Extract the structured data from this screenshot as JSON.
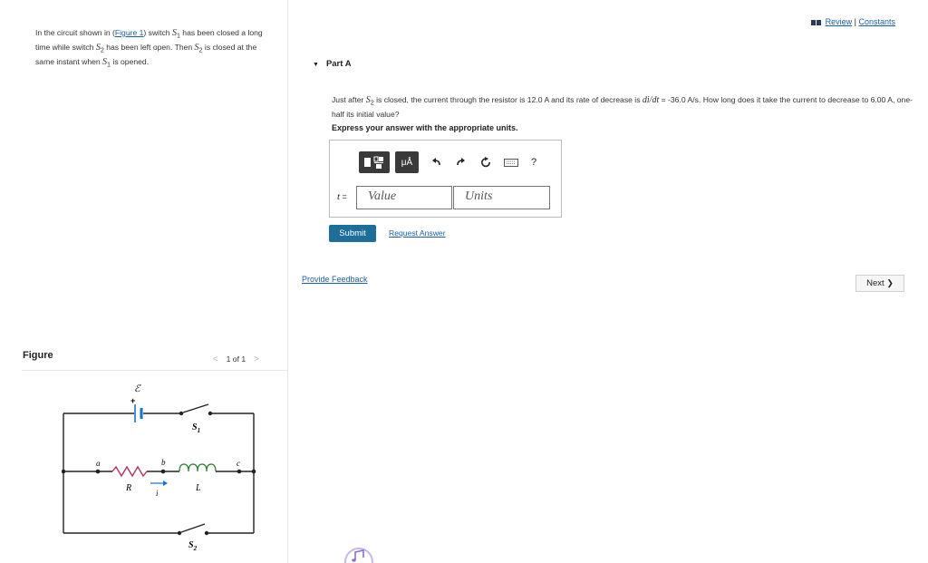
{
  "problem": {
    "t1": "In the circuit shown in (",
    "figure_link": "Figure 1",
    "t2": ") switch ",
    "s1": "S",
    "s1_sub": "1",
    "t3": " has been closed a long time while switch ",
    "s2": "S",
    "s2_sub": "2",
    "t4": " has been left open. Then ",
    "t5": " is closed at the same instant when ",
    "t6": " is opened."
  },
  "figure": {
    "label": "Figure",
    "pager": "1 of 1",
    "prev_arrow": "<",
    "next_arrow": ">",
    "circuit_labels": {
      "emf": "ℰ",
      "plus": "+",
      "s1": "S",
      "s1_sub": "1",
      "s2": "S",
      "s2_sub": "2",
      "a": "a",
      "b": "b",
      "c": "c",
      "R": "R",
      "L": "L",
      "i": "i"
    }
  },
  "header": {
    "review": "Review",
    "separator": " | ",
    "constants": "Constants"
  },
  "part": {
    "title": "Part A",
    "q1": "Just after ",
    "q_s2": "S",
    "q_s2_sub": "2",
    "q2": " is closed, the current through the resistor is 12.0 ",
    "unit_A": "A",
    "q3": " and its rate of decrease is ",
    "didt": "di/dt",
    "q4": " = -36.0 ",
    "unit_As": "A/s",
    "q5": ". How long does it take the current to decrease to 6.00 ",
    "q6": ", one-half its initial value?",
    "instruction": "Express your answer with the appropriate units."
  },
  "answer": {
    "variable": "t",
    "equals": " =",
    "value_placeholder": "Value",
    "units_placeholder": "Units",
    "toolbar": {
      "mu_label": "μÅ",
      "help_label": "?"
    }
  },
  "actions": {
    "submit": "Submit",
    "request_answer": "Request Answer",
    "provide_feedback": "Provide Feedback",
    "next": "Next",
    "next_chevron": "❯"
  },
  "colors": {
    "link": "#1a5fa8",
    "submit_bg": "#1e6e9b",
    "resistor": "#b0306a",
    "inductor": "#2e7d32",
    "battery": "#1a73c8",
    "toolbar_dark": "#3a3a3a"
  }
}
